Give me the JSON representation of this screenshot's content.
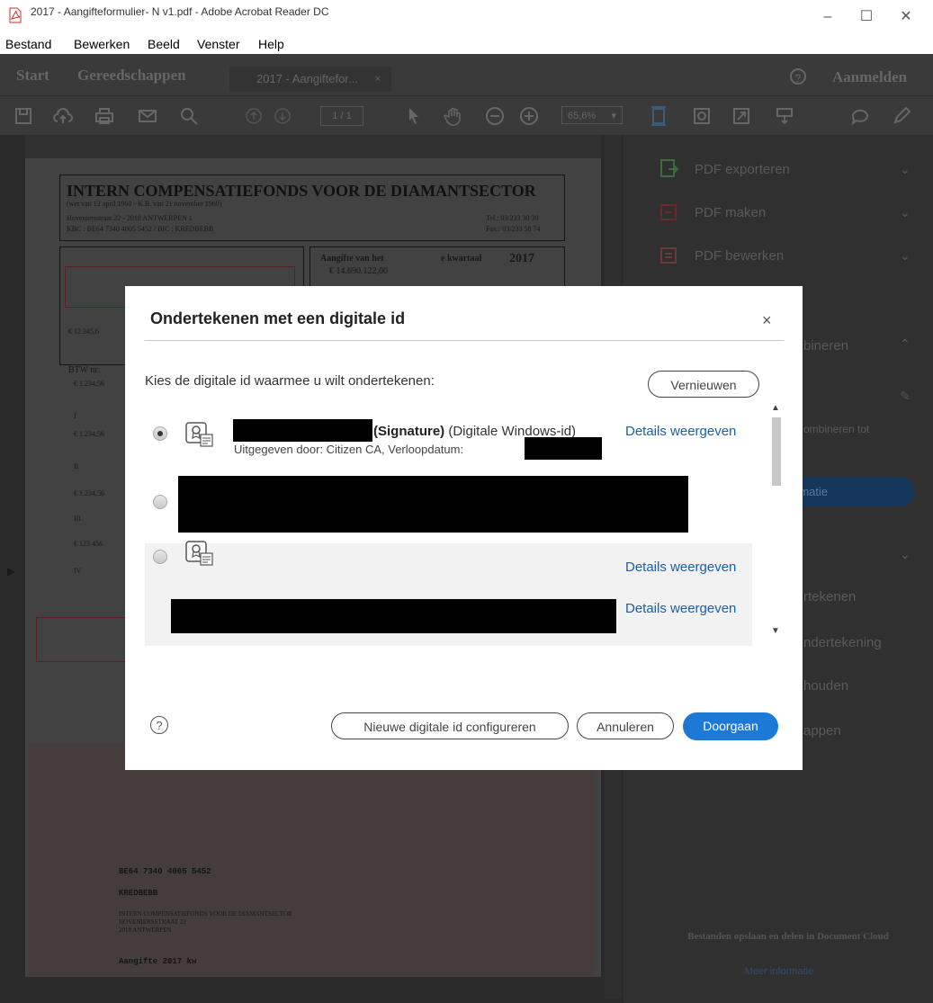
{
  "window": {
    "title": "2017 - Aangifteformulier- N v1.pdf - Adobe Acrobat Reader DC",
    "controls": [
      "–",
      "☐",
      "✕"
    ]
  },
  "menu": [
    "Bestand",
    "Bewerken",
    "Beeld",
    "Venster",
    "Help"
  ],
  "tabs": {
    "start": "Start",
    "tools": "Gereedschappen",
    "document": "2017 - Aangiftefor...",
    "document_close": "×",
    "help": "?",
    "sign_in": "Aanmelden"
  },
  "toolbar": {
    "page": "1 / 1",
    "zoom": "65,6%"
  },
  "document": {
    "heading": "INTERN COMPENSATIEFONDS VOOR DE DIAMANTSECTOR",
    "subheading": "(wet van 12 april 1960 - K.B. van 21 november 1960)",
    "address": "Hoveniersstraat 22 - 2018 ANTWERPEN 1",
    "bank": "KBC : BE64 7340 4005 5452 / BIC : KREDBEBB",
    "tel": "Tel.: 03/233 30 30",
    "fax": "Fax.: 03/233 58 74",
    "aangifte_label": "Aangifte van het",
    "kwartaal": "e kwartaal",
    "year": "2017",
    "amount": "€ 14.690.122,00",
    "btw": "BTW nr:",
    "roman": [
      "I",
      "II",
      "III",
      "IV"
    ],
    "iban": "BE64 7340 4005 5452",
    "bic": "KREDBEBB",
    "beneficiary": "INTERN COMPENSATIEFONDS VOOR DE DIAMANTSECTOR",
    "street": "HOVENIERSSTRAAT 22",
    "city": "2018 ANTWERPEN",
    "communication": "Aangifte 2017 kw",
    "small_amounts": [
      "€ 12.345,6",
      "€ 1.234,56",
      "€ 1.234,56",
      "€ 1.234,56",
      "€ 123.456"
    ]
  },
  "right_panel": {
    "items": [
      "PDF exporteren",
      "PDF maken",
      "PDF bewerken"
    ],
    "partial": [
      "bineren",
      "ombineren tot",
      "rmatie",
      "rtekenen",
      "ndertekening",
      "houden",
      "appen"
    ],
    "cloud_text": "Bestanden opslaan en delen in Document Cloud",
    "cloud_link": "Meer informatie"
  },
  "dialog": {
    "title": "Ondertekenen met een digitale id",
    "close": "×",
    "prompt": "Kies de digitale id waarmee u wilt ondertekenen:",
    "refresh": "Vernieuwen",
    "ids": [
      {
        "name_strong": "(Signature)",
        "name_type": " (Digitale Windows-id)",
        "issuer": "Uitgegeven door: Citizen CA, Verloopdatum:",
        "details": "Details weergeven",
        "selected": true
      },
      {
        "selected": false
      },
      {
        "details": "Details weergeven",
        "selected": false
      },
      {
        "details": "Details weergeven"
      }
    ],
    "help": "?",
    "configure": "Nieuwe digitale id configureren",
    "cancel": "Annuleren",
    "continue": "Doorgaan"
  },
  "colors": {
    "accent": "#1d79d6",
    "link": "#1a5fa8",
    "overlay_bg": "#2a2a2a"
  }
}
